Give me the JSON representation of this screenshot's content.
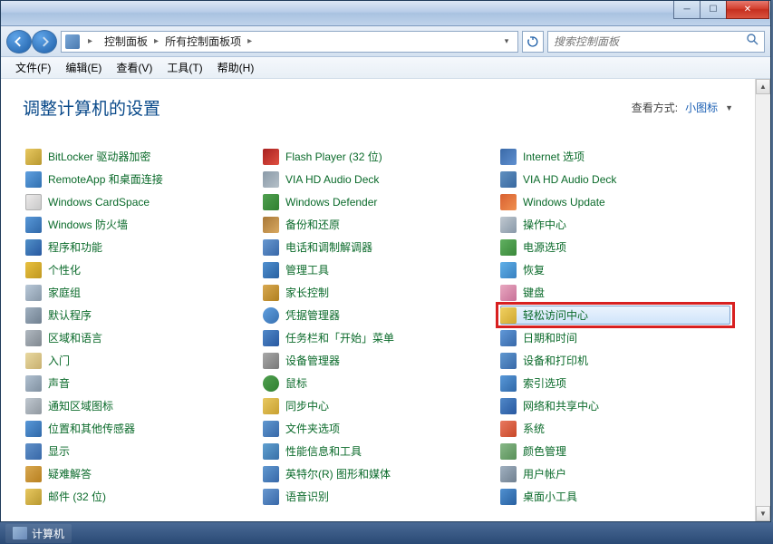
{
  "titlebar": {
    "min": "─",
    "max": "☐",
    "close": "✕"
  },
  "breadcrumb": {
    "root": "控制面板",
    "current": "所有控制面板项"
  },
  "search": {
    "placeholder": "搜索控制面板"
  },
  "menu": {
    "file": "文件(F)",
    "edit": "编辑(E)",
    "view": "查看(V)",
    "tools": "工具(T)",
    "help": "帮助(H)"
  },
  "header": {
    "title": "调整计算机的设置",
    "view_by_label": "查看方式:",
    "view_by_value": "小图标"
  },
  "items": [
    {
      "label": "BitLocker 驱动器加密",
      "icon": "ic0",
      "name": "bitlocker"
    },
    {
      "label": "Flash Player (32 位)",
      "icon": "ic1",
      "name": "flash-player"
    },
    {
      "label": "Internet 选项",
      "icon": "ic2",
      "name": "internet-options"
    },
    {
      "label": "RemoteApp 和桌面连接",
      "icon": "ic3",
      "name": "remoteapp"
    },
    {
      "label": "VIA HD Audio Deck",
      "icon": "ic4",
      "name": "via-audio-1"
    },
    {
      "label": "VIA HD Audio Deck",
      "icon": "ic5",
      "name": "via-audio-2"
    },
    {
      "label": "Windows CardSpace",
      "icon": "ic6",
      "name": "cardspace"
    },
    {
      "label": "Windows Defender",
      "icon": "ic7",
      "name": "defender"
    },
    {
      "label": "Windows Update",
      "icon": "ic8",
      "name": "windows-update"
    },
    {
      "label": "Windows 防火墙",
      "icon": "ic9",
      "name": "firewall"
    },
    {
      "label": "备份和还原",
      "icon": "ic10",
      "name": "backup-restore"
    },
    {
      "label": "操作中心",
      "icon": "ic11",
      "name": "action-center"
    },
    {
      "label": "程序和功能",
      "icon": "ic12",
      "name": "programs-features"
    },
    {
      "label": "电话和调制解调器",
      "icon": "ic13",
      "name": "phone-modem"
    },
    {
      "label": "电源选项",
      "icon": "ic14",
      "name": "power-options"
    },
    {
      "label": "个性化",
      "icon": "ic15",
      "name": "personalization"
    },
    {
      "label": "管理工具",
      "icon": "ic16",
      "name": "admin-tools"
    },
    {
      "label": "恢复",
      "icon": "ic17",
      "name": "recovery"
    },
    {
      "label": "家庭组",
      "icon": "ic18",
      "name": "homegroup"
    },
    {
      "label": "家长控制",
      "icon": "ic19",
      "name": "parental-controls"
    },
    {
      "label": "键盘",
      "icon": "ic20",
      "name": "keyboard"
    },
    {
      "label": "默认程序",
      "icon": "ic21",
      "name": "default-programs"
    },
    {
      "label": "凭据管理器",
      "icon": "ic22",
      "name": "credential-manager"
    },
    {
      "label": "轻松访问中心",
      "icon": "ic23",
      "name": "ease-of-access",
      "highlight": true
    },
    {
      "label": "区域和语言",
      "icon": "ic24",
      "name": "region-language"
    },
    {
      "label": "任务栏和「开始」菜单",
      "icon": "ic25",
      "name": "taskbar-start"
    },
    {
      "label": "日期和时间",
      "icon": "ic26",
      "name": "date-time"
    },
    {
      "label": "入门",
      "icon": "ic27",
      "name": "getting-started"
    },
    {
      "label": "设备管理器",
      "icon": "ic28",
      "name": "device-manager"
    },
    {
      "label": "设备和打印机",
      "icon": "ic29",
      "name": "devices-printers"
    },
    {
      "label": "声音",
      "icon": "ic30",
      "name": "sound"
    },
    {
      "label": "鼠标",
      "icon": "ic31",
      "name": "mouse"
    },
    {
      "label": "索引选项",
      "icon": "ic32",
      "name": "indexing-options"
    },
    {
      "label": "通知区域图标",
      "icon": "ic33",
      "name": "notification-icons"
    },
    {
      "label": "同步中心",
      "icon": "ic34",
      "name": "sync-center"
    },
    {
      "label": "网络和共享中心",
      "icon": "ic35",
      "name": "network-sharing"
    },
    {
      "label": "位置和其他传感器",
      "icon": "ic36",
      "name": "location-sensors"
    },
    {
      "label": "文件夹选项",
      "icon": "ic37",
      "name": "folder-options"
    },
    {
      "label": "系统",
      "icon": "ic38",
      "name": "system"
    },
    {
      "label": "显示",
      "icon": "ic39",
      "name": "display"
    },
    {
      "label": "性能信息和工具",
      "icon": "ic40",
      "name": "performance-info"
    },
    {
      "label": "颜色管理",
      "icon": "ic41",
      "name": "color-management"
    },
    {
      "label": "疑难解答",
      "icon": "ic42",
      "name": "troubleshooting"
    },
    {
      "label": "英特尔(R) 图形和媒体",
      "icon": "ic43",
      "name": "intel-graphics"
    },
    {
      "label": "用户帐户",
      "icon": "ic44",
      "name": "user-accounts"
    },
    {
      "label": "邮件 (32 位)",
      "icon": "ic0",
      "name": "mail"
    },
    {
      "label": "语音识别",
      "icon": "ic13",
      "name": "speech-recognition"
    },
    {
      "label": "桌面小工具",
      "icon": "ic16",
      "name": "desktop-gadgets"
    }
  ],
  "taskbar": {
    "item": "计算机"
  }
}
